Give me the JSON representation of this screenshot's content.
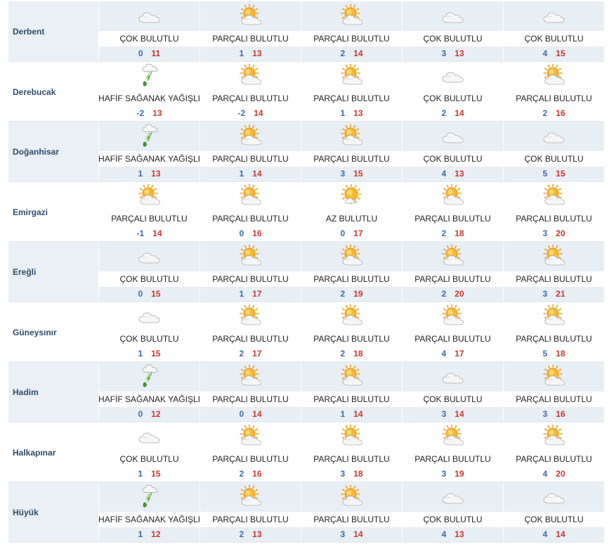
{
  "conditions": {
    "cok": "ÇOK BULUTLU",
    "parcali": "PARÇALI BULUTLU",
    "az": "AZ BULUTLU",
    "hafif": "HAFİF SAĞANAK YAĞIŞLI"
  },
  "rows": [
    {
      "city": "Derbent",
      "days": [
        {
          "cond": "ÇOK BULUTLU",
          "icon": "cloud-icon",
          "min": "0",
          "max": "11"
        },
        {
          "cond": "PARÇALI BULUTLU",
          "icon": "partly-cloudy-icon",
          "min": "1",
          "max": "13"
        },
        {
          "cond": "PARÇALI BULUTLU",
          "icon": "partly-cloudy-icon",
          "min": "2",
          "max": "14"
        },
        {
          "cond": "ÇOK BULUTLU",
          "icon": "cloud-icon",
          "min": "3",
          "max": "13"
        },
        {
          "cond": "ÇOK BULUTLU",
          "icon": "cloud-icon",
          "min": "4",
          "max": "15"
        }
      ]
    },
    {
      "city": "Derebucak",
      "days": [
        {
          "cond": "HAFİF SAĞANAK YAĞIŞLI",
          "icon": "light-shower-icon",
          "min": "-2",
          "max": "13"
        },
        {
          "cond": "PARÇALI BULUTLU",
          "icon": "partly-cloudy-icon",
          "min": "-2",
          "max": "14"
        },
        {
          "cond": "PARÇALI BULUTLU",
          "icon": "partly-cloudy-icon",
          "min": "1",
          "max": "13"
        },
        {
          "cond": "ÇOK BULUTLU",
          "icon": "cloud-icon",
          "min": "2",
          "max": "14"
        },
        {
          "cond": "PARÇALI BULUTLU",
          "icon": "partly-cloudy-icon",
          "min": "2",
          "max": "16"
        }
      ]
    },
    {
      "city": "Doğanhisar",
      "days": [
        {
          "cond": "HAFİF SAĞANAK YAĞIŞLI",
          "icon": "light-shower-icon",
          "min": "1",
          "max": "13"
        },
        {
          "cond": "PARÇALI BULUTLU",
          "icon": "partly-cloudy-icon",
          "min": "1",
          "max": "14"
        },
        {
          "cond": "PARÇALI BULUTLU",
          "icon": "partly-cloudy-icon",
          "min": "3",
          "max": "15"
        },
        {
          "cond": "ÇOK BULUTLU",
          "icon": "cloud-icon",
          "min": "4",
          "max": "13"
        },
        {
          "cond": "ÇOK BULUTLU",
          "icon": "cloud-icon",
          "min": "5",
          "max": "15"
        }
      ]
    },
    {
      "city": "Emirgazi",
      "days": [
        {
          "cond": "PARÇALI BULUTLU",
          "icon": "partly-cloudy-icon",
          "min": "-1",
          "max": "14"
        },
        {
          "cond": "PARÇALI BULUTLU",
          "icon": "partly-cloudy-icon",
          "min": "0",
          "max": "16"
        },
        {
          "cond": "AZ BULUTLU",
          "icon": "mostly-sunny-icon",
          "min": "0",
          "max": "17"
        },
        {
          "cond": "PARÇALI BULUTLU",
          "icon": "partly-cloudy-icon",
          "min": "2",
          "max": "18"
        },
        {
          "cond": "PARÇALI BULUTLU",
          "icon": "partly-cloudy-icon",
          "min": "3",
          "max": "20"
        }
      ]
    },
    {
      "city": "Ereğli",
      "days": [
        {
          "cond": "ÇOK BULUTLU",
          "icon": "cloud-icon",
          "min": "0",
          "max": "15"
        },
        {
          "cond": "PARÇALI BULUTLU",
          "icon": "partly-cloudy-icon",
          "min": "1",
          "max": "17"
        },
        {
          "cond": "PARÇALI BULUTLU",
          "icon": "partly-cloudy-icon",
          "min": "2",
          "max": "19"
        },
        {
          "cond": "PARÇALI BULUTLU",
          "icon": "partly-cloudy-icon",
          "min": "2",
          "max": "20"
        },
        {
          "cond": "PARÇALI BULUTLU",
          "icon": "partly-cloudy-icon",
          "min": "3",
          "max": "21"
        }
      ]
    },
    {
      "city": "Güneysınır",
      "days": [
        {
          "cond": "ÇOK BULUTLU",
          "icon": "cloud-icon",
          "min": "1",
          "max": "15"
        },
        {
          "cond": "PARÇALI BULUTLU",
          "icon": "partly-cloudy-icon",
          "min": "2",
          "max": "17"
        },
        {
          "cond": "PARÇALI BULUTLU",
          "icon": "partly-cloudy-icon",
          "min": "2",
          "max": "18"
        },
        {
          "cond": "PARÇALI BULUTLU",
          "icon": "partly-cloudy-icon",
          "min": "4",
          "max": "17"
        },
        {
          "cond": "PARÇALI BULUTLU",
          "icon": "partly-cloudy-icon",
          "min": "5",
          "max": "18"
        }
      ]
    },
    {
      "city": "Hadim",
      "days": [
        {
          "cond": "HAFİF SAĞANAK YAĞIŞLI",
          "icon": "light-shower-icon",
          "min": "0",
          "max": "12"
        },
        {
          "cond": "PARÇALI BULUTLU",
          "icon": "partly-cloudy-icon",
          "min": "0",
          "max": "14"
        },
        {
          "cond": "PARÇALI BULUTLU",
          "icon": "partly-cloudy-icon",
          "min": "1",
          "max": "14"
        },
        {
          "cond": "ÇOK BULUTLU",
          "icon": "cloud-icon",
          "min": "3",
          "max": "14"
        },
        {
          "cond": "PARÇALI BULUTLU",
          "icon": "partly-cloudy-icon",
          "min": "3",
          "max": "16"
        }
      ]
    },
    {
      "city": "Halkapınar",
      "days": [
        {
          "cond": "ÇOK BULUTLU",
          "icon": "cloud-icon",
          "min": "1",
          "max": "15"
        },
        {
          "cond": "PARÇALI BULUTLU",
          "icon": "partly-cloudy-icon",
          "min": "2",
          "max": "16"
        },
        {
          "cond": "PARÇALI BULUTLU",
          "icon": "partly-cloudy-icon",
          "min": "3",
          "max": "18"
        },
        {
          "cond": "PARÇALI BULUTLU",
          "icon": "partly-cloudy-icon",
          "min": "3",
          "max": "19"
        },
        {
          "cond": "PARÇALI BULUTLU",
          "icon": "partly-cloudy-icon",
          "min": "4",
          "max": "20"
        }
      ]
    },
    {
      "city": "Hüyük",
      "days": [
        {
          "cond": "HAFİF SAĞANAK YAĞIŞLI",
          "icon": "light-shower-icon",
          "min": "1",
          "max": "12"
        },
        {
          "cond": "PARÇALI BULUTLU",
          "icon": "partly-cloudy-icon",
          "min": "2",
          "max": "13"
        },
        {
          "cond": "PARÇALI BULUTLU",
          "icon": "partly-cloudy-icon",
          "min": "3",
          "max": "14"
        },
        {
          "cond": "ÇOK BULUTLU",
          "icon": "cloud-icon",
          "min": "4",
          "max": "13"
        },
        {
          "cond": "ÇOK BULUTLU",
          "icon": "cloud-icon",
          "min": "4",
          "max": "14"
        }
      ]
    }
  ],
  "colors": {
    "min_temp": "#3a6aa8",
    "max_temp": "#c9362f",
    "shaded_row": "#e7eef4",
    "city_text": "#2c4c6a"
  }
}
